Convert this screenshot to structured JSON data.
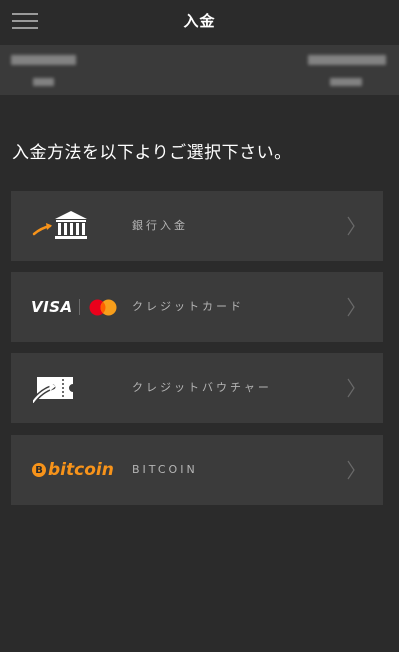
{
  "header": {
    "title": "入金"
  },
  "instruction": "入金方法を以下よりご選択下さい。",
  "methods": [
    {
      "id": "bank",
      "label": "銀行入金",
      "icon": "bank-icon"
    },
    {
      "id": "credit-card",
      "label": "クレジットカード",
      "icon": "visa-mastercard-icon",
      "brand_text": "VISA"
    },
    {
      "id": "credit-voucher",
      "label": "クレジットバウチャー",
      "icon": "voucher-ticket-icon"
    },
    {
      "id": "bitcoin",
      "label": "BITCOIN",
      "icon": "bitcoin-icon",
      "brand_text": "bitcoin",
      "brand_symbol": "B"
    }
  ],
  "colors": {
    "background": "#2b2b2b",
    "card": "#3b3b3b",
    "accent_orange": "#f7931a",
    "mastercard_red": "#eb001b",
    "mastercard_yellow": "#f79e1b"
  }
}
